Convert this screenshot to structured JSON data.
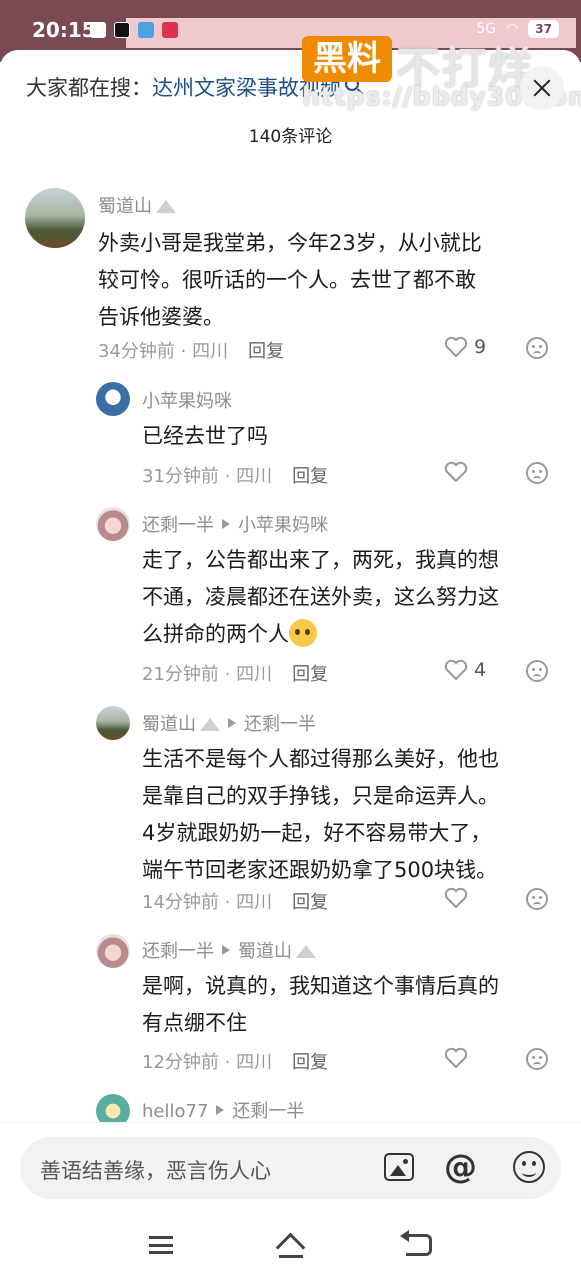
{
  "status_bar": {
    "time": "20:15",
    "network": "5G",
    "battery": "37"
  },
  "search": {
    "prefix": "大家都在搜：",
    "term": "达州文家梁事故视频"
  },
  "watermark": {
    "badge": "黑料",
    "text": "不打烊",
    "url": "https://bbdy30.com"
  },
  "header": {
    "comment_count": "140条评论"
  },
  "comments": [
    {
      "user": "蜀道山",
      "text_lines": [
        "外卖小哥是我堂弟，今年23岁，从小就比",
        "较可怜。很听话的一个人。去世了都不敢",
        "告诉他婆婆。"
      ],
      "time": "34分钟前 · 四川",
      "reply": "回复",
      "likes": "9"
    },
    {
      "user": "小苹果妈咪",
      "text_lines": [
        "已经去世了吗"
      ],
      "time": "31分钟前 · 四川",
      "reply": "回复",
      "likes": ""
    },
    {
      "user": "还剩一半",
      "reply_to": "小苹果妈咪",
      "text_lines": [
        "走了，公告都出来了，两死，我真的想",
        "不通，凌晨都还在送外卖，这么努力这",
        "么拼命的两个人"
      ],
      "time": "21分钟前 · 四川",
      "reply": "回复",
      "likes": "4"
    },
    {
      "user": "蜀道山",
      "reply_to": "还剩一半",
      "text_lines": [
        "生活不是每个人都过得那么美好，他也",
        "是靠自己的双手挣钱，只是命运弄人。",
        "4岁就跟奶奶一起，好不容易带大了，",
        "端午节回老家还跟奶奶拿了500块钱。"
      ],
      "time": "14分钟前 · 四川",
      "reply": "回复",
      "likes": ""
    },
    {
      "user": "还剩一半",
      "reply_to": "蜀道山",
      "text_lines": [
        "是啊，说真的，我知道这个事情后真的",
        "有点绷不住"
      ],
      "time": "12分钟前 · 四川",
      "reply": "回复",
      "likes": ""
    },
    {
      "user": "hello77",
      "reply_to": "还剩一半"
    }
  ],
  "input": {
    "placeholder": "善语结善缘，恶言伤人心"
  },
  "colors": {
    "status_bar": "#7a4a52",
    "link": "#1d4e89",
    "meta": "#9a9a9a"
  }
}
